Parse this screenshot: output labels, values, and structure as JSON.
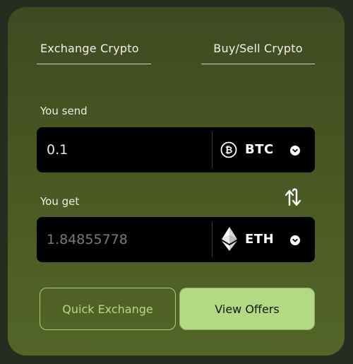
{
  "tabs": [
    {
      "label": "Exchange Crypto"
    },
    {
      "label": "Buy/Sell Crypto"
    }
  ],
  "send": {
    "label": "You send",
    "amount": "0.1",
    "currency": "BTC",
    "icon": "bitcoin-icon"
  },
  "get": {
    "label": "You get",
    "amount_placeholder": "1.84855778",
    "currency": "ETH",
    "icon": "ethereum-icon"
  },
  "buttons": {
    "quick_exchange": "Quick Exchange",
    "view_offers": "View Offers"
  },
  "colors": {
    "page_background": "#252c20",
    "card_gradient_top": "#3f4a21",
    "card_gradient_bottom": "#546528",
    "accent_green": "#b3d985",
    "field_background": "#000000"
  }
}
